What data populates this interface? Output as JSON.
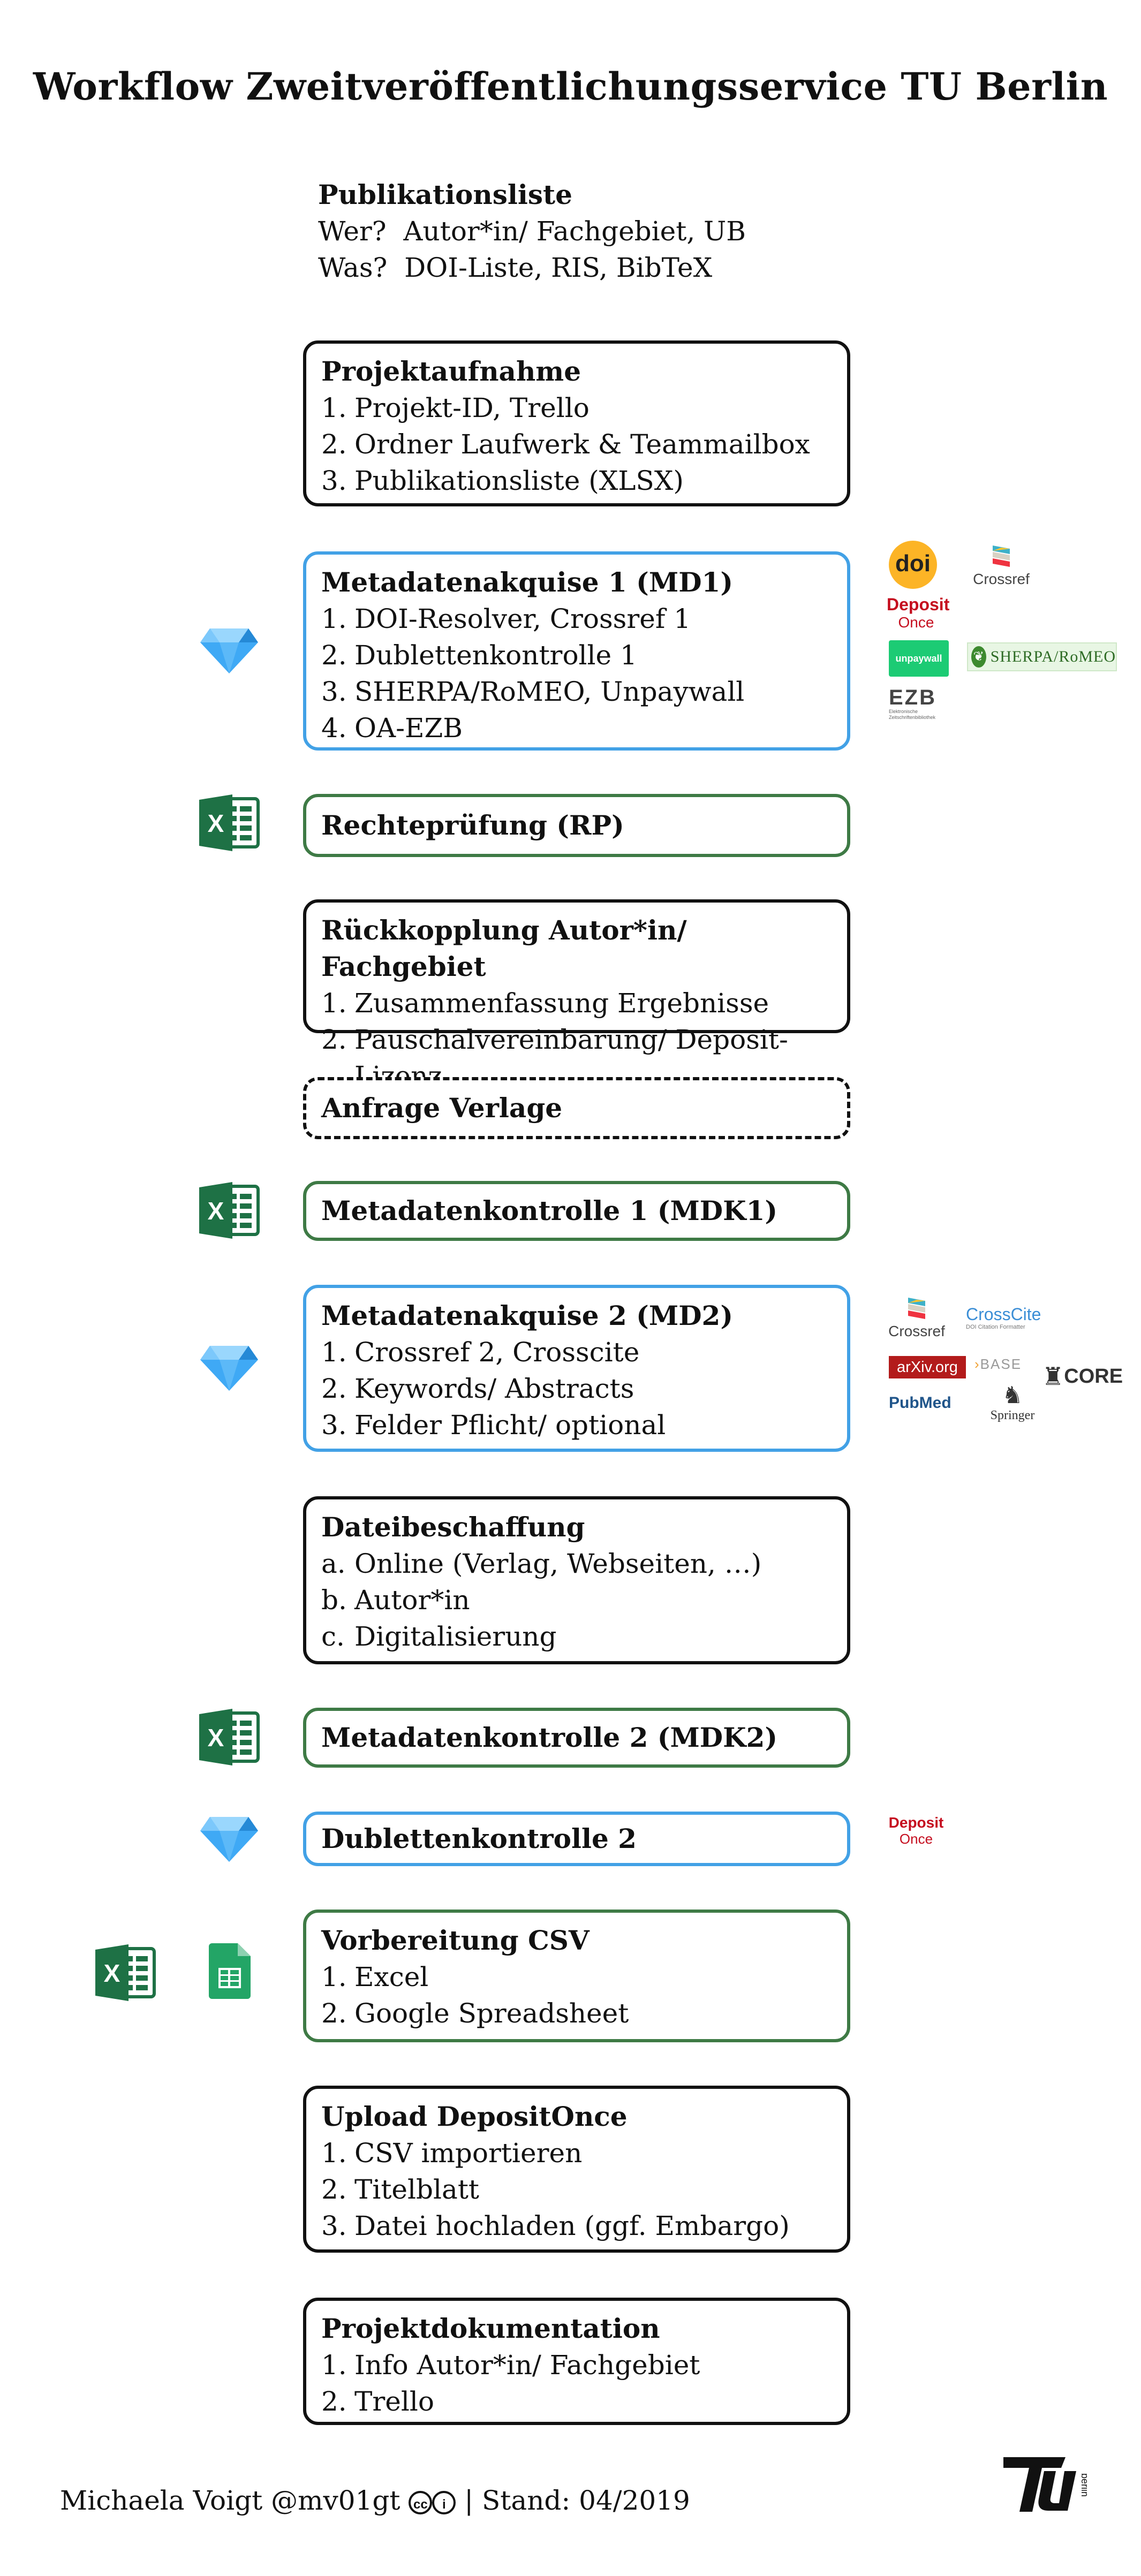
{
  "title": "Workflow Zweitveröffentlichungsservice TU Berlin",
  "publist": {
    "heading": "Publikationsliste",
    "wer_label": "Wer?",
    "wer": "Autor*in/ Fachgebiet, UB",
    "was_label": "Was?",
    "was": "DOI-Liste, RIS, BibTeX"
  },
  "steps": {
    "projektaufnahme": {
      "title": "Projektaufnahme",
      "items": [
        "Projekt-ID, Trello",
        "Ordner Laufwerk & Teammailbox",
        "Publikationsliste (XLSX)"
      ]
    },
    "md1": {
      "title": "Metadatenakquise 1 (MD1)",
      "items": [
        "DOI-Resolver, Crossref 1",
        "Dublettenkontrolle 1",
        "SHERPA/RoMEO, Unpaywall",
        "OA-EZB"
      ]
    },
    "rp": {
      "title": "Rechteprüfung (RP)"
    },
    "rueck": {
      "title": "Rückkopplung Autor*in/ Fachgebiet",
      "items": [
        "Zusammenfassung Ergebnisse",
        "Pauschalvereinbarung/ Deposit-Lizenz"
      ]
    },
    "anfrage": {
      "title": "Anfrage Verlage"
    },
    "mdk1": {
      "title": "Metadatenkontrolle 1 (MDK1)"
    },
    "md2": {
      "title": "Metadatenakquise 2 (MD2)",
      "items": [
        "Crossref 2, Crosscite",
        "Keywords/ Abstracts",
        "Felder Pflicht/ optional"
      ]
    },
    "datei": {
      "title": "Dateibeschaffung",
      "markers": [
        "a.",
        "b.",
        "c."
      ],
      "items": [
        "Online (Verlag, Webseiten, …)",
        "Autor*in",
        "Digitalisierung"
      ]
    },
    "mdk2": {
      "title": "Metadatenkontrolle 2 (MDK2)"
    },
    "dub2": {
      "title": "Dublettenkontrolle 2"
    },
    "csv": {
      "title": "Vorbereitung CSV",
      "items": [
        "Excel",
        "Google Spreadsheet"
      ]
    },
    "upload": {
      "title": "Upload DepositOnce",
      "items": [
        "CSV importieren",
        "Titelblatt",
        "Datei hochladen (ggf. Embargo)"
      ]
    },
    "doku": {
      "title": "Projektdokumentation",
      "items": [
        "Info Autor*in/ Fachgebiet",
        "Trello"
      ]
    }
  },
  "numbers": [
    "1.",
    "2.",
    "3.",
    "4."
  ],
  "logos": {
    "doi": "doi",
    "crossref": "Crossref",
    "deposit_1": "Deposit",
    "deposit_2": "Once",
    "unpaywall": "unpaywall",
    "sherpa": "SHERPA/RoMEO",
    "ezb": "EZB",
    "ezb_sub": "Elektronische Zeitschriftenbibliothek",
    "crosscite": "CrossCite",
    "crosscite_sub": "DOI Citation Formatter",
    "arxiv": "arXiv.org",
    "base": "BASE",
    "core": "CORE",
    "pubmed": "PubMed",
    "springer": "Springer",
    "excel_letter": "X",
    "tu": "TU",
    "tu_sub": "berlin"
  },
  "footer": {
    "author": "Michaela Voigt @mv01gt",
    "cc": "cc",
    "by": "i",
    "stand": "| Stand: 04/2019"
  },
  "colors": {
    "blue": "#42a1e6",
    "green": "#3e7a45",
    "excel": "#1e7145",
    "sheets": "#23a566",
    "diamond": "#3fa9f5"
  }
}
